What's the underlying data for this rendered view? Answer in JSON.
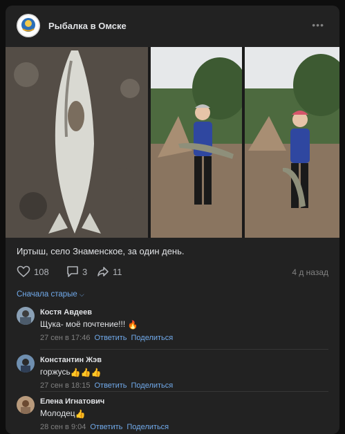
{
  "group": {
    "name": "Рыбалка в Омске",
    "more_icon": "more-horizontal-icon"
  },
  "post": {
    "text": "Иртыш, село Знаменское, за один день.",
    "likes": "108",
    "comments": "3",
    "shares": "11",
    "date": "4 д назад"
  },
  "comments_section": {
    "sort_label": "Сначала старые",
    "items": [
      {
        "author": "Костя Авдеев",
        "text": "Щука- моё почтение!!! ",
        "emoji": "🔥",
        "date": "27 сен в 17:46",
        "reply": "Ответить",
        "share": "Поделиться"
      },
      {
        "author": "Константин Жэв",
        "text": "горжусь",
        "emoji": "👍👍👍",
        "date": "27 сен в 18:15",
        "reply": "Ответить",
        "share": "Поделиться"
      },
      {
        "author": "Елена Игнатович",
        "text": "Молодец",
        "emoji": "👍",
        "date": "28 сен в 9:04",
        "reply": "Ответить",
        "share": "Поделиться"
      }
    ]
  },
  "colors": {
    "card": "#222222",
    "link": "#71aaeb",
    "muted": "#828282",
    "text": "#e1e3e6"
  }
}
